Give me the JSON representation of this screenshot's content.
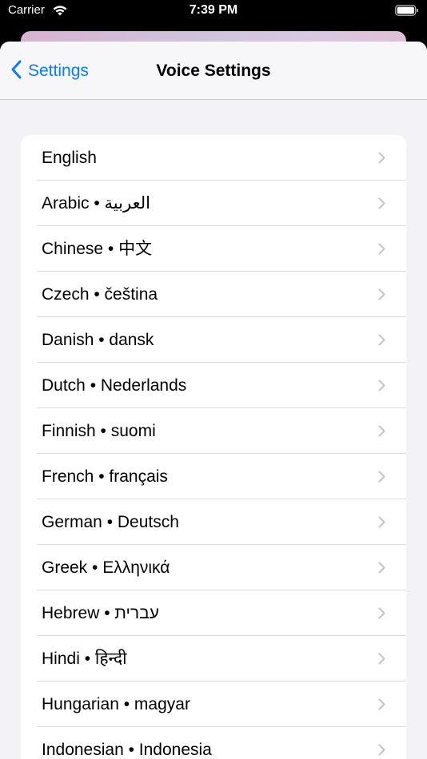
{
  "status_bar": {
    "carrier": "Carrier",
    "time": "7:39 PM"
  },
  "navbar": {
    "back_label": "Settings",
    "title": "Voice Settings"
  },
  "languages": [
    "English",
    "Arabic • العربية",
    "Chinese • 中文",
    "Czech • čeština",
    "Danish • dansk",
    "Dutch • Nederlands",
    "Finnish • suomi",
    "French • français",
    "German • Deutsch",
    "Greek • Ελληνικά",
    "Hebrew • עברית",
    "Hindi • हिन्दी",
    "Hungarian • magyar",
    "Indonesian • Indonesia"
  ],
  "icons": {
    "wifi": "wifi-icon",
    "battery": "battery-icon",
    "back": "chevron-left-icon",
    "row": "chevron-right-icon"
  },
  "colors": {
    "accent": "#0a7aff",
    "chevron": "#c4c4c7"
  }
}
